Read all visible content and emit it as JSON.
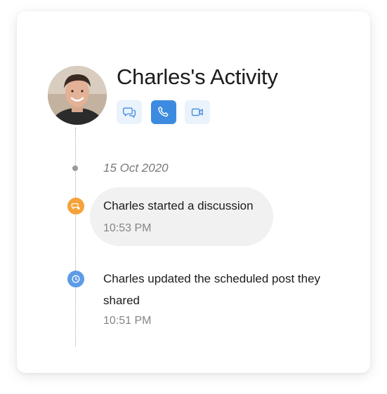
{
  "header": {
    "title": "Charles's Activity",
    "avatar_alt": "Charles avatar"
  },
  "actions": [
    {
      "name": "chat",
      "icon": "chat-bubbles-icon",
      "active": false
    },
    {
      "name": "call",
      "icon": "phone-icon",
      "active": true
    },
    {
      "name": "video",
      "icon": "video-camera-icon",
      "active": false
    }
  ],
  "timeline": {
    "date": "15 Oct 2020",
    "events": [
      {
        "text": "Charles started a discussion",
        "time": "10:53 PM",
        "icon": "discussion-icon",
        "icon_color": "#f5a23a",
        "highlighted": true
      },
      {
        "text": "Charles updated the scheduled post they shared",
        "time": "10:51 PM",
        "icon": "clock-icon",
        "icon_color": "#5d9be8",
        "highlighted": false
      }
    ]
  },
  "colors": {
    "accent": "#3d8be0",
    "accent_light": "#eaf2fc",
    "bubble": "#f1f1f1"
  }
}
